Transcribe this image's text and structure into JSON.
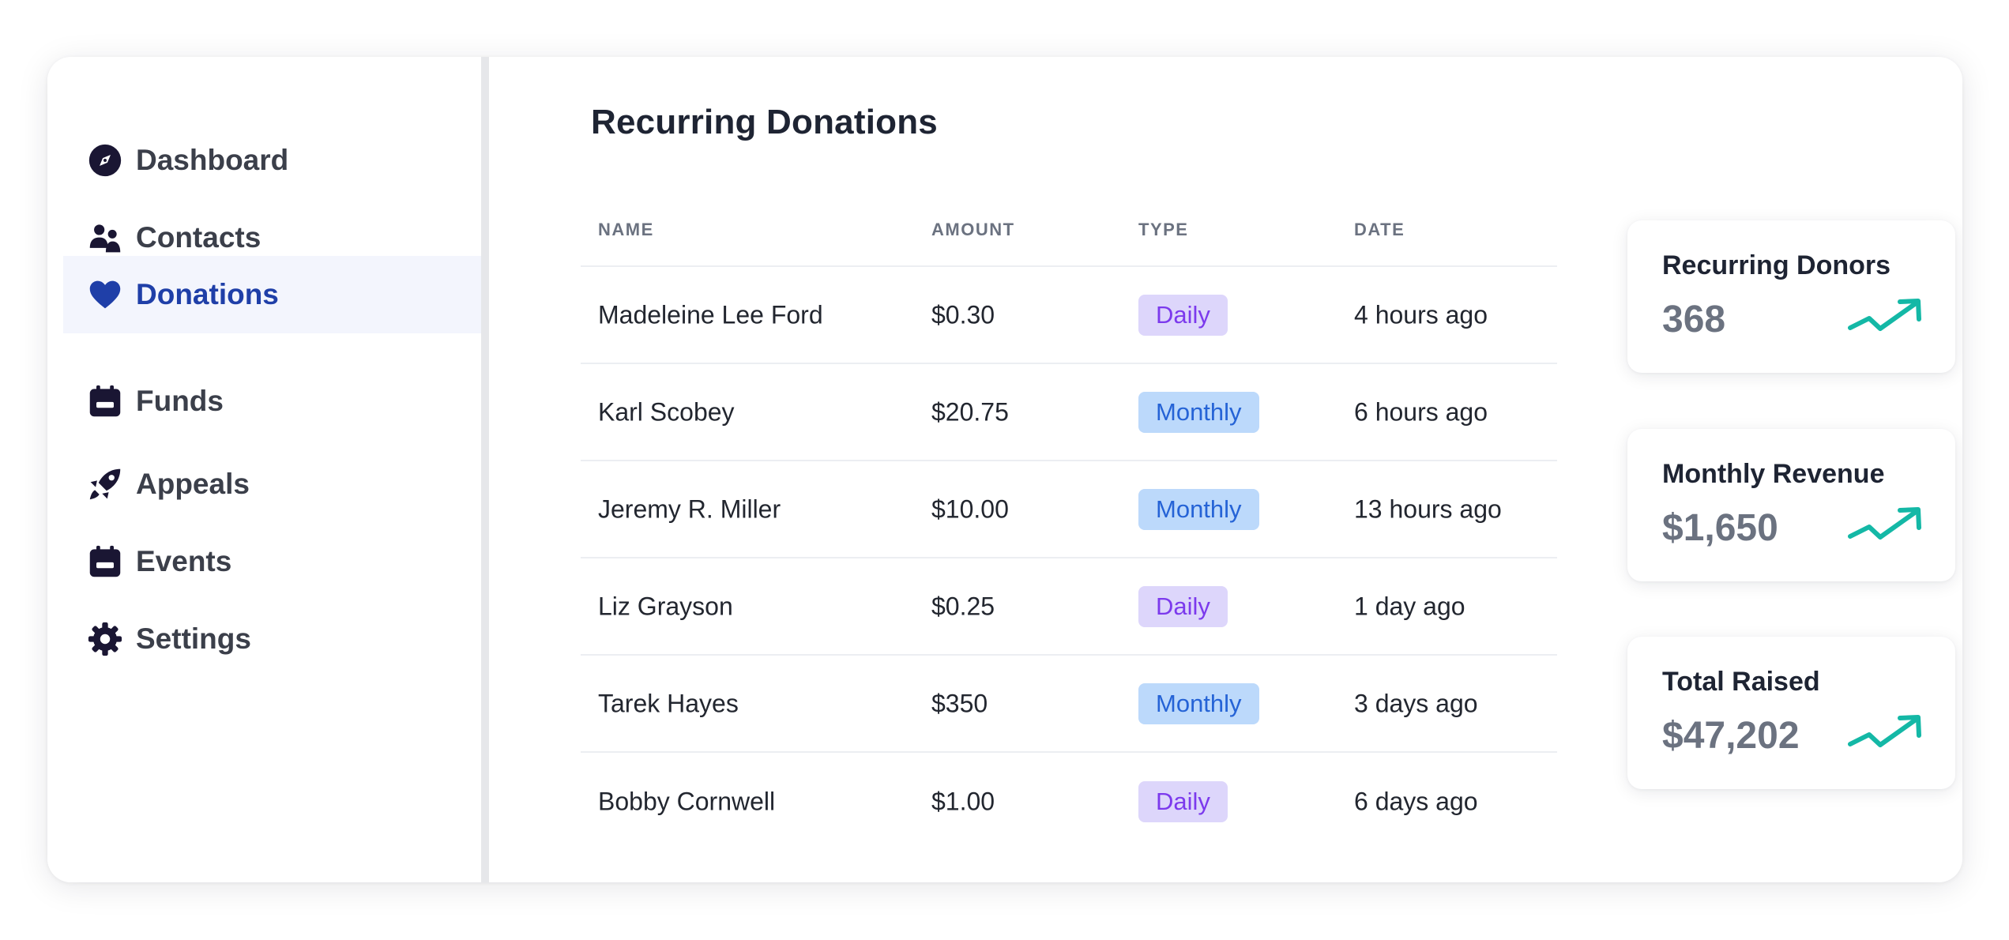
{
  "colors": {
    "accent": "#1f3fa8",
    "trend": "#14b8a6",
    "daily_badge_bg": "#ddd6fb",
    "daily_badge_text": "#7c3aed",
    "monthly_badge_bg": "#bcd9fb",
    "monthly_badge_text": "#2563d6"
  },
  "sidebar": {
    "items": [
      {
        "label": "Dashboard",
        "icon": "compass-icon",
        "active": false
      },
      {
        "label": "Contacts",
        "icon": "users-icon",
        "active": false
      },
      {
        "label": "Donations",
        "icon": "heart-icon",
        "active": true
      },
      {
        "label": "Funds",
        "icon": "calendar-icon",
        "active": false
      },
      {
        "label": "Appeals",
        "icon": "rocket-icon",
        "active": false
      },
      {
        "label": "Events",
        "icon": "calendar-icon",
        "active": false
      },
      {
        "label": "Settings",
        "icon": "gear-icon",
        "active": false
      }
    ]
  },
  "main": {
    "title": "Recurring Donations",
    "table": {
      "headers": {
        "name": "NAME",
        "amount": "AMOUNT",
        "type": "TYPE",
        "date": "DATE"
      },
      "rows": [
        {
          "name": "Madeleine Lee Ford",
          "amount": "$0.30",
          "type": "Daily",
          "date": "4 hours ago"
        },
        {
          "name": "Karl Scobey",
          "amount": "$20.75",
          "type": "Monthly",
          "date": "6 hours ago"
        },
        {
          "name": "Jeremy R. Miller",
          "amount": "$10.00",
          "type": "Monthly",
          "date": "13 hours ago"
        },
        {
          "name": "Liz Grayson",
          "amount": "$0.25",
          "type": "Daily",
          "date": "1 day ago"
        },
        {
          "name": "Tarek Hayes",
          "amount": "$350",
          "type": "Monthly",
          "date": "3 days ago"
        },
        {
          "name": "Bobby Cornwell",
          "amount": "$1.00",
          "type": "Daily",
          "date": "6 days ago"
        }
      ]
    },
    "stats": [
      {
        "title": "Recurring Donors",
        "value": "368",
        "icon": "trending-up-icon"
      },
      {
        "title": "Monthly Revenue",
        "value": "$1,650",
        "icon": "trending-up-icon"
      },
      {
        "title": "Total Raised",
        "value": "$47,202",
        "icon": "trending-up-icon"
      }
    ]
  }
}
